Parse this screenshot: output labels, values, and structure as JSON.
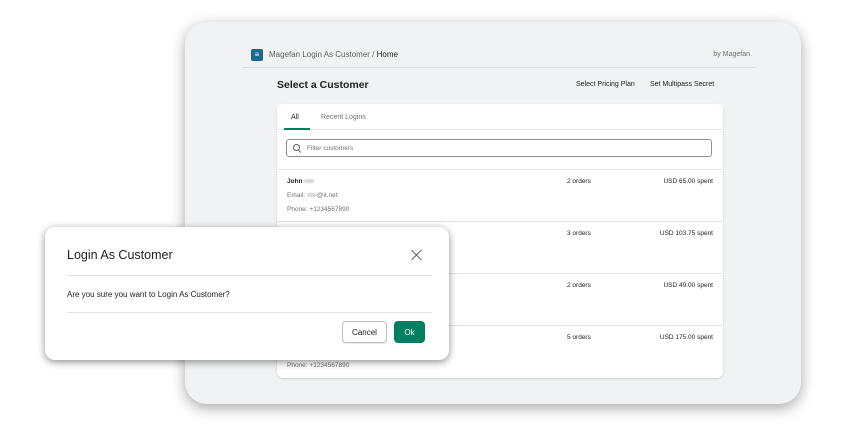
{
  "app": {
    "logo_letter": "≡",
    "breadcrumb_parent": "Magefan Login As Customer",
    "breadcrumb_sep": " / ",
    "breadcrumb_current": "Home",
    "by": "by Magefan"
  },
  "page": {
    "title": "Select a Customer",
    "link_pricing": "Select Pricing Plan",
    "link_secret": "Set Multipass Secret"
  },
  "tabs": [
    {
      "label": "All",
      "active": true
    },
    {
      "label": "Recent Logins",
      "active": false
    }
  ],
  "search": {
    "placeholder": "Filter customers"
  },
  "customers": [
    {
      "name": "John",
      "email_prefix": "Email: ",
      "email_suffix": "@it.net",
      "phone": "Phone: +1234567890",
      "orders": "2 orders",
      "spent": "USD 65.00 spent"
    },
    {
      "orders": "3 orders",
      "spent": "USD 103.75 spent"
    },
    {
      "orders": "2 orders",
      "spent": "USD 49.00 spent"
    },
    {
      "phone": "Phone: +1234567890",
      "orders": "5 orders",
      "spent": "USD 175.00 spent"
    }
  ],
  "modal": {
    "title": "Login As Customer",
    "body": "Are you sure you want to Login As Customer?",
    "cancel": "Cancel",
    "ok": "Ok"
  },
  "colors": {
    "accent": "#008060",
    "logo": "#1a6b8e"
  }
}
